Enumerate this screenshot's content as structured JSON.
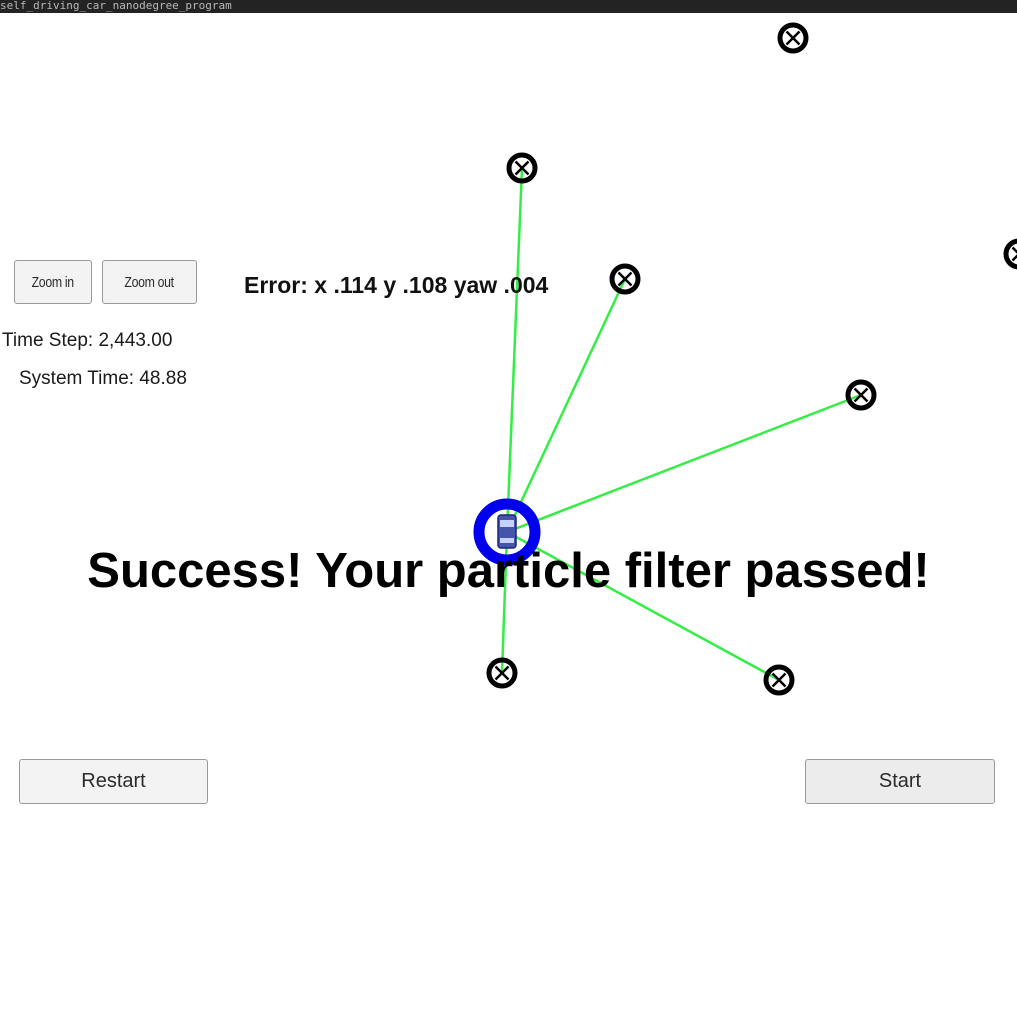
{
  "window": {
    "title": "self_driving_car_nanodegree_program"
  },
  "controls": {
    "zoom_in_label": "Zoom in",
    "zoom_out_label": "Zoom out",
    "restart_label": "Restart",
    "start_label": "Start"
  },
  "stats": {
    "time_step": "Time Step: 2,443.00",
    "system_time": "System Time: 48.88"
  },
  "error_readout": "Error: x .114 y .108 yaw .004",
  "status_message": "Success! Your particle filter passed!",
  "colors": {
    "observation_line": "#33ee44",
    "car_ring": "#0000ee",
    "landmark": "#000000",
    "title_bar": "#232323"
  },
  "icons": {
    "landmark": "landmark-x-circle-icon",
    "vehicle": "car-icon"
  }
}
